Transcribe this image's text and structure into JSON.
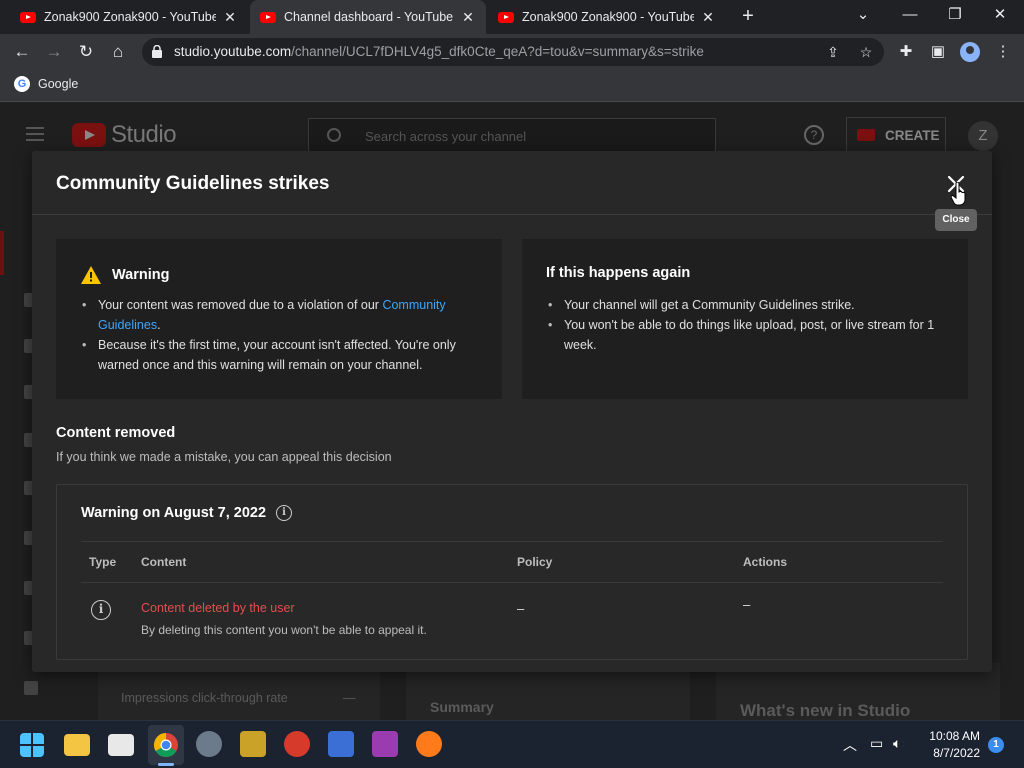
{
  "browser": {
    "tabs": [
      {
        "title": "Zonak900 Zonak900 - YouTube",
        "active": false
      },
      {
        "title": "Channel dashboard - YouTube St",
        "active": true
      },
      {
        "title": "Zonak900 Zonak900 - YouTube",
        "active": false
      }
    ],
    "url_host": "studio.youtube.com",
    "url_path": "/channel/UCL7fDHLV4g5_dfk0Cte_qeA?d=tou&v=summary&s=strike",
    "bookmark": "Google"
  },
  "studio": {
    "logo_text": "Studio",
    "search_placeholder": "Search across your channel",
    "create_label": "CREATE",
    "avatar_letter": "Z",
    "bg_impressions": "Impressions click-through rate",
    "bg_dash": "—",
    "bg_summary": "Summary",
    "bg_whats_new": "What's new in Studio"
  },
  "modal": {
    "title": "Community Guidelines strikes",
    "close_tooltip": "Close",
    "warning_card": {
      "heading": "Warning",
      "item1_text": "Your content was removed due to a violation of our ",
      "item1_link": "Community Guidelines",
      "item1_end": ".",
      "item2": "Because it's the first time, your account isn't affected. You're only warned once and this warning will remain on your channel."
    },
    "again_card": {
      "heading": "If this happens again",
      "item1": "Your channel will get a Community Guidelines strike.",
      "item2": "You won't be able to do things like upload, post, or live stream for 1 week."
    },
    "content_removed": {
      "title": "Content removed",
      "subtitle": "If you think we made a mistake, you can appeal this decision"
    },
    "warning_box": {
      "title": "Warning on August 7, 2022",
      "columns": [
        "Type",
        "Content",
        "Policy",
        "Actions"
      ],
      "row": {
        "title": "Content deleted by the user",
        "subtitle": "By deleting this content you won't be able to appeal it.",
        "policy": "–",
        "actions": "–"
      }
    }
  },
  "taskbar": {
    "time": "10:08 AM",
    "date": "8/7/2022",
    "notifications": "1"
  },
  "colors": {
    "link": "#3ea6ff",
    "removed_red": "#e54d4d",
    "warning_yellow": "#f9c400",
    "brand_red": "#ff0000"
  }
}
